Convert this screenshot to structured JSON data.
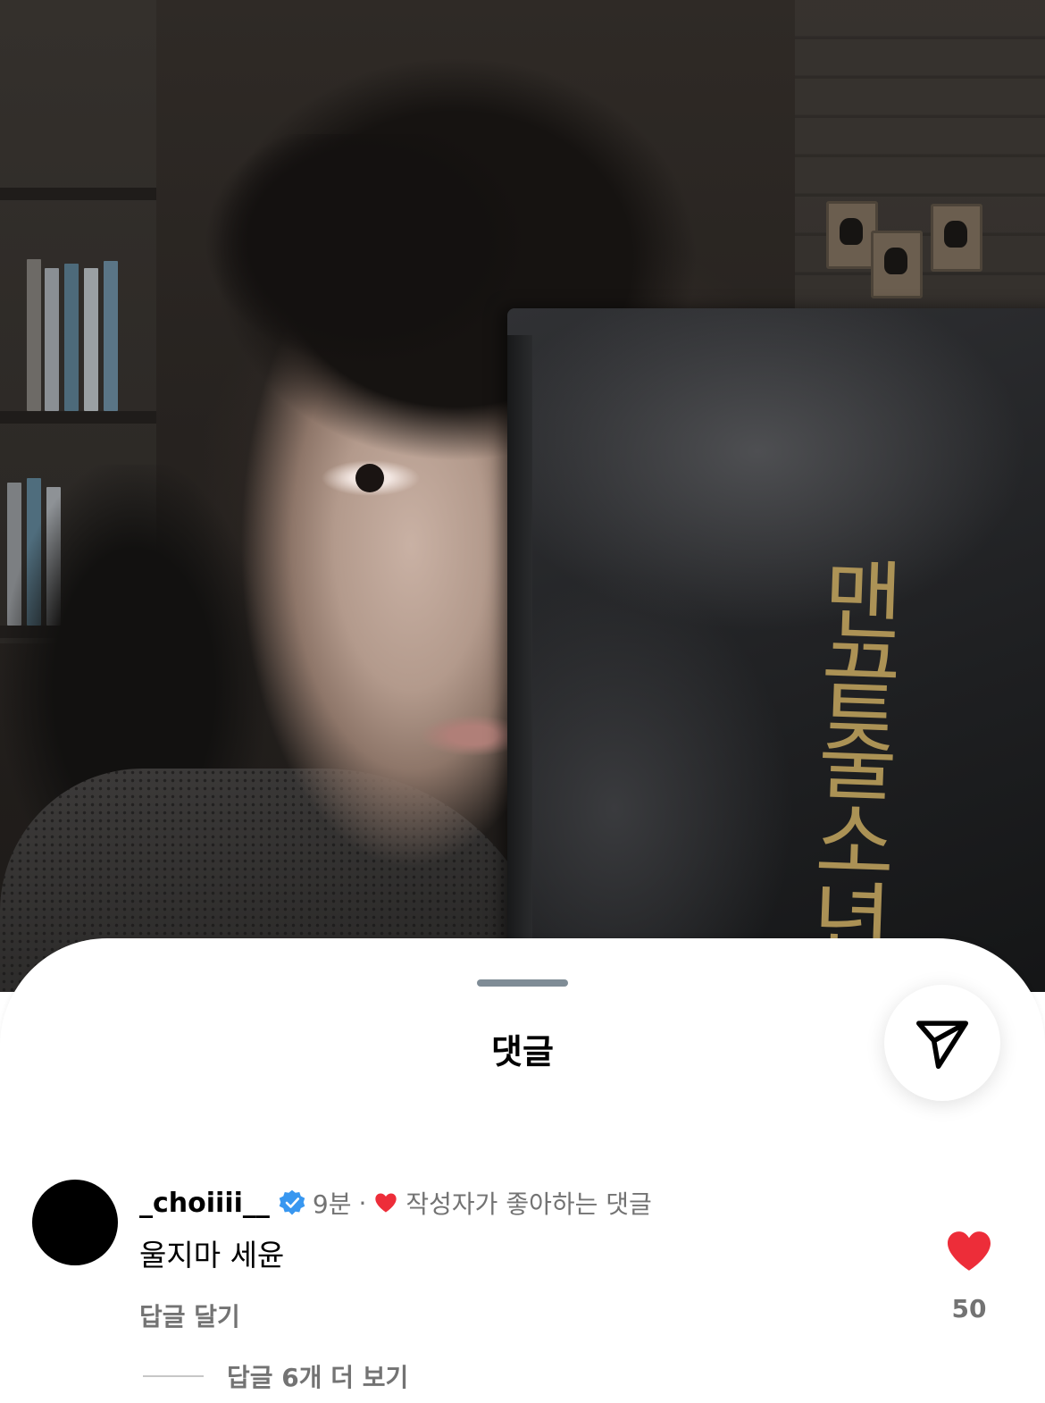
{
  "sheet": {
    "title": "댓글"
  },
  "photo": {
    "book_title": "맨끝줄소년"
  },
  "comment": {
    "username": "_choiiii__",
    "verified": true,
    "time": "9분",
    "separator": "·",
    "liked_by_author": "작성자가 좋아하는 댓글",
    "text": "울지마 세윤",
    "reply_label": "답글 달기",
    "like_count": "50",
    "liked": true,
    "view_replies": "답글 6개 더 보기"
  },
  "colors": {
    "heart": "#ed4956",
    "verified": "#3897f0",
    "secondary_text": "#737373"
  },
  "icons": {
    "share": "send-icon",
    "like": "heart-icon",
    "verified": "verified-badge-icon"
  }
}
